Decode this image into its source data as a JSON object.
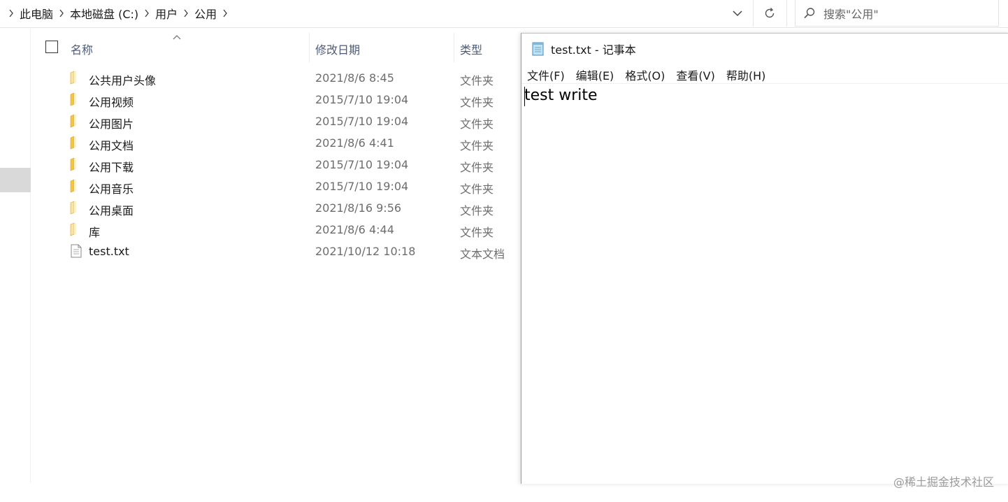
{
  "breadcrumb": {
    "items": [
      "此电脑",
      "本地磁盘 (C:)",
      "用户",
      "公用"
    ]
  },
  "search": {
    "placeholder": "搜索\"公用\""
  },
  "file_list": {
    "columns": {
      "name": "名称",
      "date": "修改日期",
      "type": "类型"
    },
    "rows": [
      {
        "name": "公共用户头像",
        "date": "2021/8/6 8:45",
        "type": "文件夹",
        "icon": "folder-icon"
      },
      {
        "name": "公用视频",
        "date": "2015/7/10 19:04",
        "type": "文件夹",
        "icon": "folder-icon"
      },
      {
        "name": "公用图片",
        "date": "2015/7/10 19:04",
        "type": "文件夹",
        "icon": "folder-icon"
      },
      {
        "name": "公用文档",
        "date": "2021/8/6 4:41",
        "type": "文件夹",
        "icon": "folder-icon"
      },
      {
        "name": "公用下载",
        "date": "2015/7/10 19:04",
        "type": "文件夹",
        "icon": "folder-icon"
      },
      {
        "name": "公用音乐",
        "date": "2015/7/10 19:04",
        "type": "文件夹",
        "icon": "folder-icon"
      },
      {
        "name": "公用桌面",
        "date": "2021/8/16 9:56",
        "type": "文件夹",
        "icon": "folder-icon"
      },
      {
        "name": "库",
        "date": "2021/8/6 4:44",
        "type": "文件夹",
        "icon": "folder-icon"
      },
      {
        "name": "test.txt",
        "date": "2021/10/12 10:18",
        "type": "文本文档",
        "icon": "text-file-icon"
      }
    ]
  },
  "notepad": {
    "title": "test.txt - 记事本",
    "menus": [
      "文件(F)",
      "编辑(E)",
      "格式(O)",
      "查看(V)",
      "帮助(H)"
    ],
    "content": "test write"
  },
  "watermark": "@稀土掘金技术社区",
  "colors": {
    "folder": "#f4c542",
    "header_text": "#4d5a78",
    "secondary_text": "#6d6d6d",
    "nav_selected": "#d9d9d9"
  }
}
